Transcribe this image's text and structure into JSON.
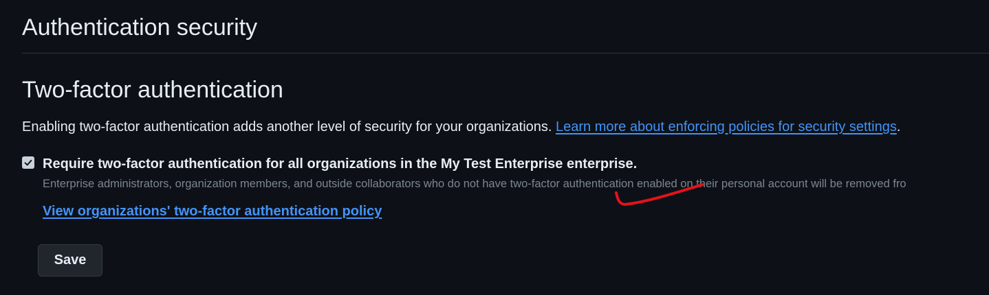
{
  "page": {
    "title": "Authentication security"
  },
  "two_factor": {
    "title": "Two-factor authentication",
    "description": "Enabling two-factor authentication adds another level of security for your organizations.",
    "learn_more_link": "Learn more about enforcing policies for security settings",
    "description_end": ".",
    "require_checkbox": {
      "checked": true,
      "label": "Require two-factor authentication for all organizations in the My Test Enterprise enterprise.",
      "note": "Enterprise administrators, organization members, and outside collaborators who do not have two-factor authentication enabled on their personal account will be removed fro"
    },
    "policy_link": "View organizations' two-factor authentication policy",
    "save_label": "Save"
  },
  "colors": {
    "background": "#0d1117",
    "text": "#e6edf3",
    "muted_text": "#7d8590",
    "link": "#4493f8",
    "divider": "#30363d",
    "button_bg": "#21262d",
    "annotation": "#e5121b"
  }
}
